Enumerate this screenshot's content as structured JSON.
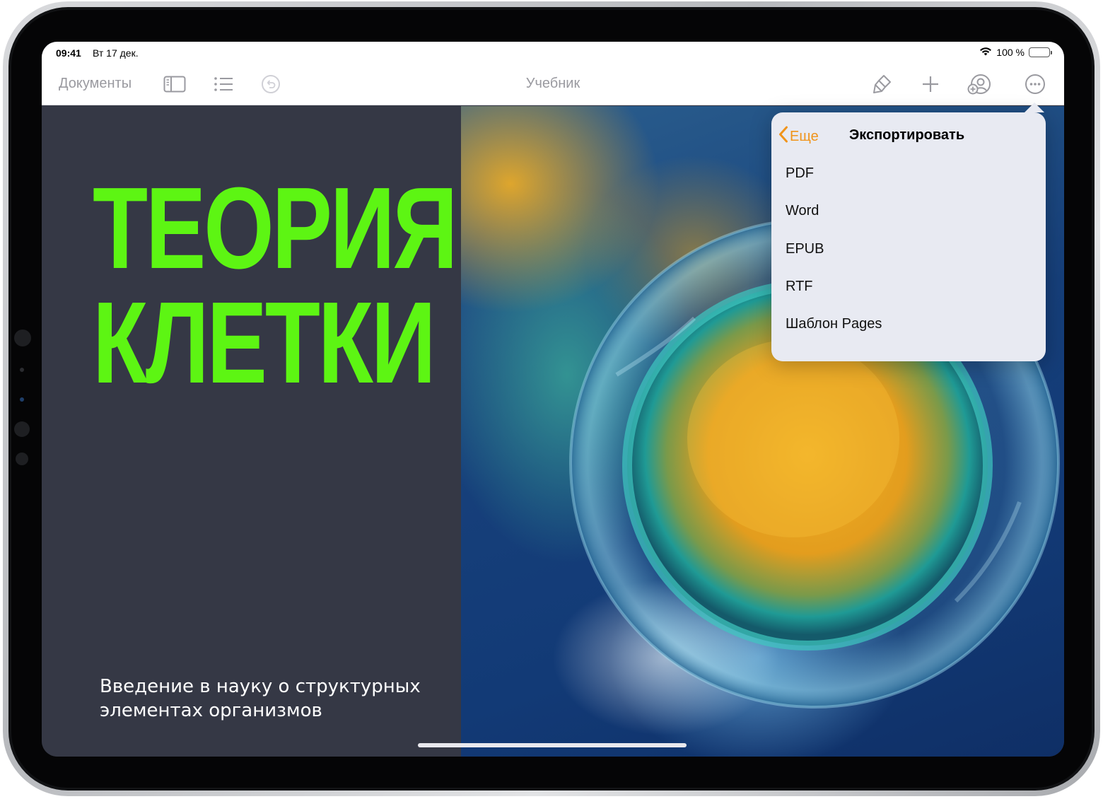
{
  "status_bar": {
    "time": "09:41",
    "date": "Вт 17 дек.",
    "battery": "100 %"
  },
  "toolbar": {
    "documents_label": "Документы",
    "title": "Учебник",
    "icons": [
      "sidebar-icon",
      "list-icon",
      "undo-icon",
      "paintbrush-icon",
      "plus-icon",
      "collaborate-icon",
      "more-icon"
    ]
  },
  "document": {
    "heading_line1": "ТЕОРИЯ",
    "heading_line2": "КЛЕТКИ",
    "subtitle": "Введение в науку о структурных\nэлементах организмов"
  },
  "popover": {
    "back_label": "Еще",
    "title": "Экспортировать",
    "items": [
      {
        "label": "PDF"
      },
      {
        "label": "Word"
      },
      {
        "label": "EPUB"
      },
      {
        "label": "RTF"
      },
      {
        "label": "Шаблон Pages"
      }
    ]
  },
  "colors": {
    "accent_orange": "#f0941b",
    "heading_green": "#5df513",
    "page_left_bg": "#353845",
    "toolbar_gray": "#9a9aa0"
  }
}
